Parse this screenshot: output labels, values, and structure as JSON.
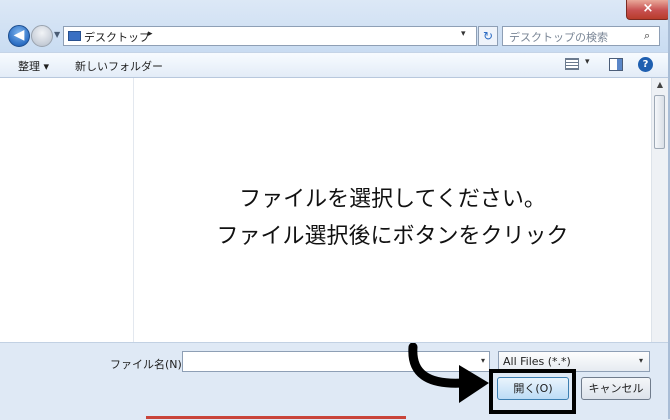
{
  "window": {
    "close_label": "×"
  },
  "nav": {
    "back_label": "◀",
    "history_label": "▼"
  },
  "address": {
    "location": "デスクトップ",
    "separator": "▸",
    "dropdown": "▾",
    "refresh": "↻"
  },
  "search": {
    "placeholder": "デスクトップの検索",
    "icon": "search-icon"
  },
  "toolbar": {
    "organize_label": "整理 ▾",
    "new_folder_label": "新しいフォルダー",
    "view_dropdown": "▾",
    "help_label": "?"
  },
  "scroll": {
    "up_arrow": "▲"
  },
  "overlay": {
    "line1": "ファイルを選択してください。",
    "line2": "ファイル選択後にボタンをクリック"
  },
  "bottom": {
    "filename_label": "ファイル名(N):",
    "filename_value": "",
    "filename_dropdown": "▾",
    "filter_value": "All Files (*.*)",
    "filter_dropdown": "▾",
    "open_label": "開く(O)",
    "cancel_label": "キャンセル"
  },
  "colors": {
    "highlight": "#000000",
    "accent": "#c9443a",
    "address_icon": "#3a6fc2"
  }
}
